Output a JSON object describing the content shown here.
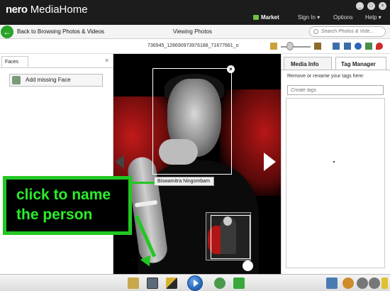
{
  "app": {
    "logo_brand": "nero",
    "logo_product": "MediaHome",
    "window_buttons": [
      "_",
      "□",
      "×"
    ]
  },
  "menu": {
    "market": "Market",
    "sign_in": "Sign In ▾",
    "options": "Options",
    "help": "Help ▾"
  },
  "nav": {
    "back_label": "Back to Browsing Photos & Videos",
    "view_title": "Viewing Photos",
    "search_placeholder": "Search Photos & Vide..."
  },
  "toolbar": {
    "filename": "736945_128690973976188_71677661_o"
  },
  "faces_panel": {
    "tab_label": "Faces",
    "close": "×",
    "add_missing_face": "Add missing Face"
  },
  "viewer": {
    "face_name": "Biswamitra Ningombam",
    "face_close": "×"
  },
  "tag_panel": {
    "tab_media_info": "Media Info",
    "tab_tag_manager": "Tag Manager",
    "description": "Remove or rename your tags here:",
    "input_placeholder": "Create tags"
  },
  "annotation": {
    "text": "click to name\nthe person",
    "color": "#22c722"
  },
  "colors": {
    "titlebar": "#1c1c1c",
    "accent_green": "#28a428",
    "viewer_bg": "#000000"
  }
}
